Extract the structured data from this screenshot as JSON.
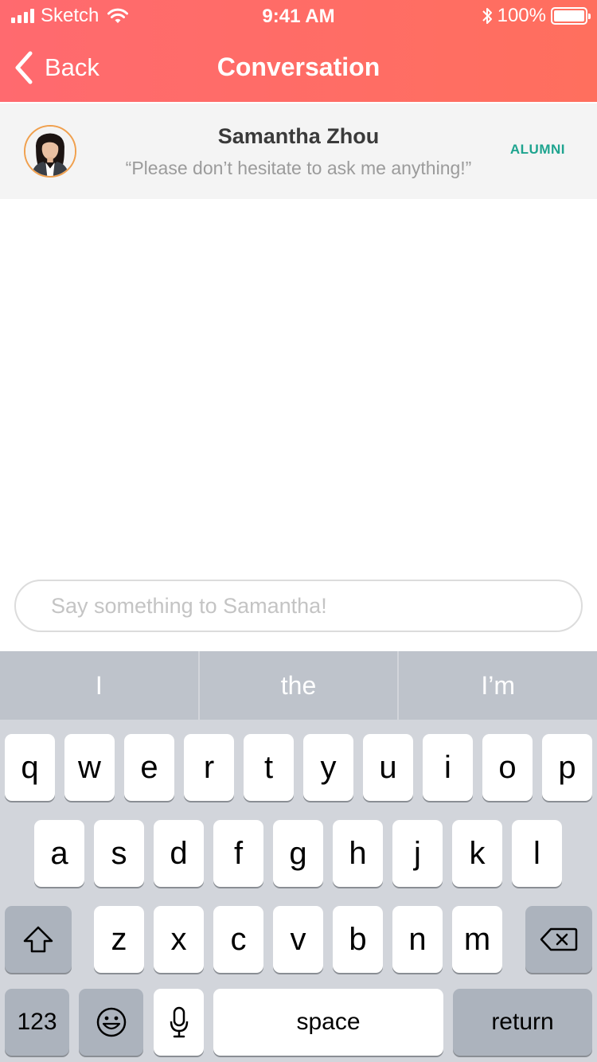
{
  "status_bar": {
    "carrier": "Sketch",
    "time": "9:41 AM",
    "battery_percent": "100%"
  },
  "nav": {
    "back_label": "Back",
    "title": "Conversation"
  },
  "profile": {
    "name": "Samantha Zhou",
    "quote": "“Please don’t hesitate to ask me anything!”",
    "badge": "ALUMNI",
    "badge_color": "#1ea48f"
  },
  "message_input": {
    "placeholder": "Say something to Samantha!",
    "value": ""
  },
  "keyboard": {
    "suggestions": [
      "I",
      "the",
      "I’m"
    ],
    "row1": [
      "q",
      "w",
      "e",
      "r",
      "t",
      "y",
      "u",
      "i",
      "o",
      "p"
    ],
    "row2": [
      "a",
      "s",
      "d",
      "f",
      "g",
      "h",
      "j",
      "k",
      "l"
    ],
    "row3": [
      "z",
      "x",
      "c",
      "v",
      "b",
      "n",
      "m"
    ],
    "numbers_label": "123",
    "space_label": "space",
    "return_label": "return",
    "icons": [
      "shift-icon",
      "backspace-icon",
      "emoji-icon",
      "microphone-icon"
    ]
  },
  "colors": {
    "header_start": "#ff6a6f",
    "header_end": "#ff6f5e",
    "avatar_ring": "#f0a04e"
  }
}
